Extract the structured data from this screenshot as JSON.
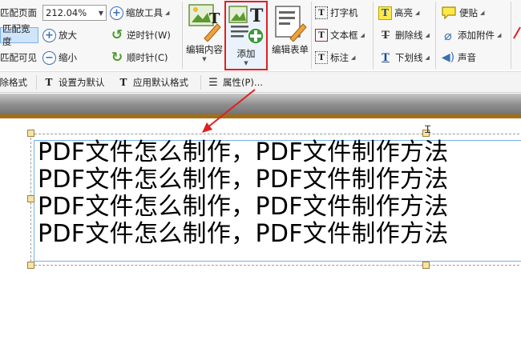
{
  "toolbar": {
    "fit_page": "匹配页面",
    "zoom_value": "212.04%",
    "zoom_tool": "缩放工具",
    "fit_width": "匹配宽度",
    "zoom_in": "放大",
    "rotate_ccw": "逆时针(W)",
    "fit_visible": "匹配可见",
    "zoom_out": "缩小",
    "rotate_cw": "顺时针(C)",
    "edit_content": "编辑内容",
    "add": "添加",
    "edit_form": "编辑表单",
    "typewriter": "打字机",
    "textbox": "文本框",
    "callout": "标注",
    "highlight": "高亮",
    "strikeout": "删除线",
    "underline": "下划线",
    "note": "便贴",
    "attach_file": "添加附件",
    "sound": "声音"
  },
  "toolbar2": {
    "clear_format": "清除格式",
    "set_default": "设置为默认",
    "apply_default": "应用默认格式",
    "properties": "属性(P)..."
  },
  "document": {
    "lines": [
      "PDF文件怎么制作，PDF文件制作方法",
      "PDF文件怎么制作，PDF文件制作方法",
      "PDF文件怎么制作，PDF文件制作方法",
      "PDF文件怎么制作，PDF文件制作方法"
    ]
  },
  "colors": {
    "annotation_arrow": "#e02020",
    "selection_border": "#77aee6",
    "active_button": "#cfe5fb"
  }
}
